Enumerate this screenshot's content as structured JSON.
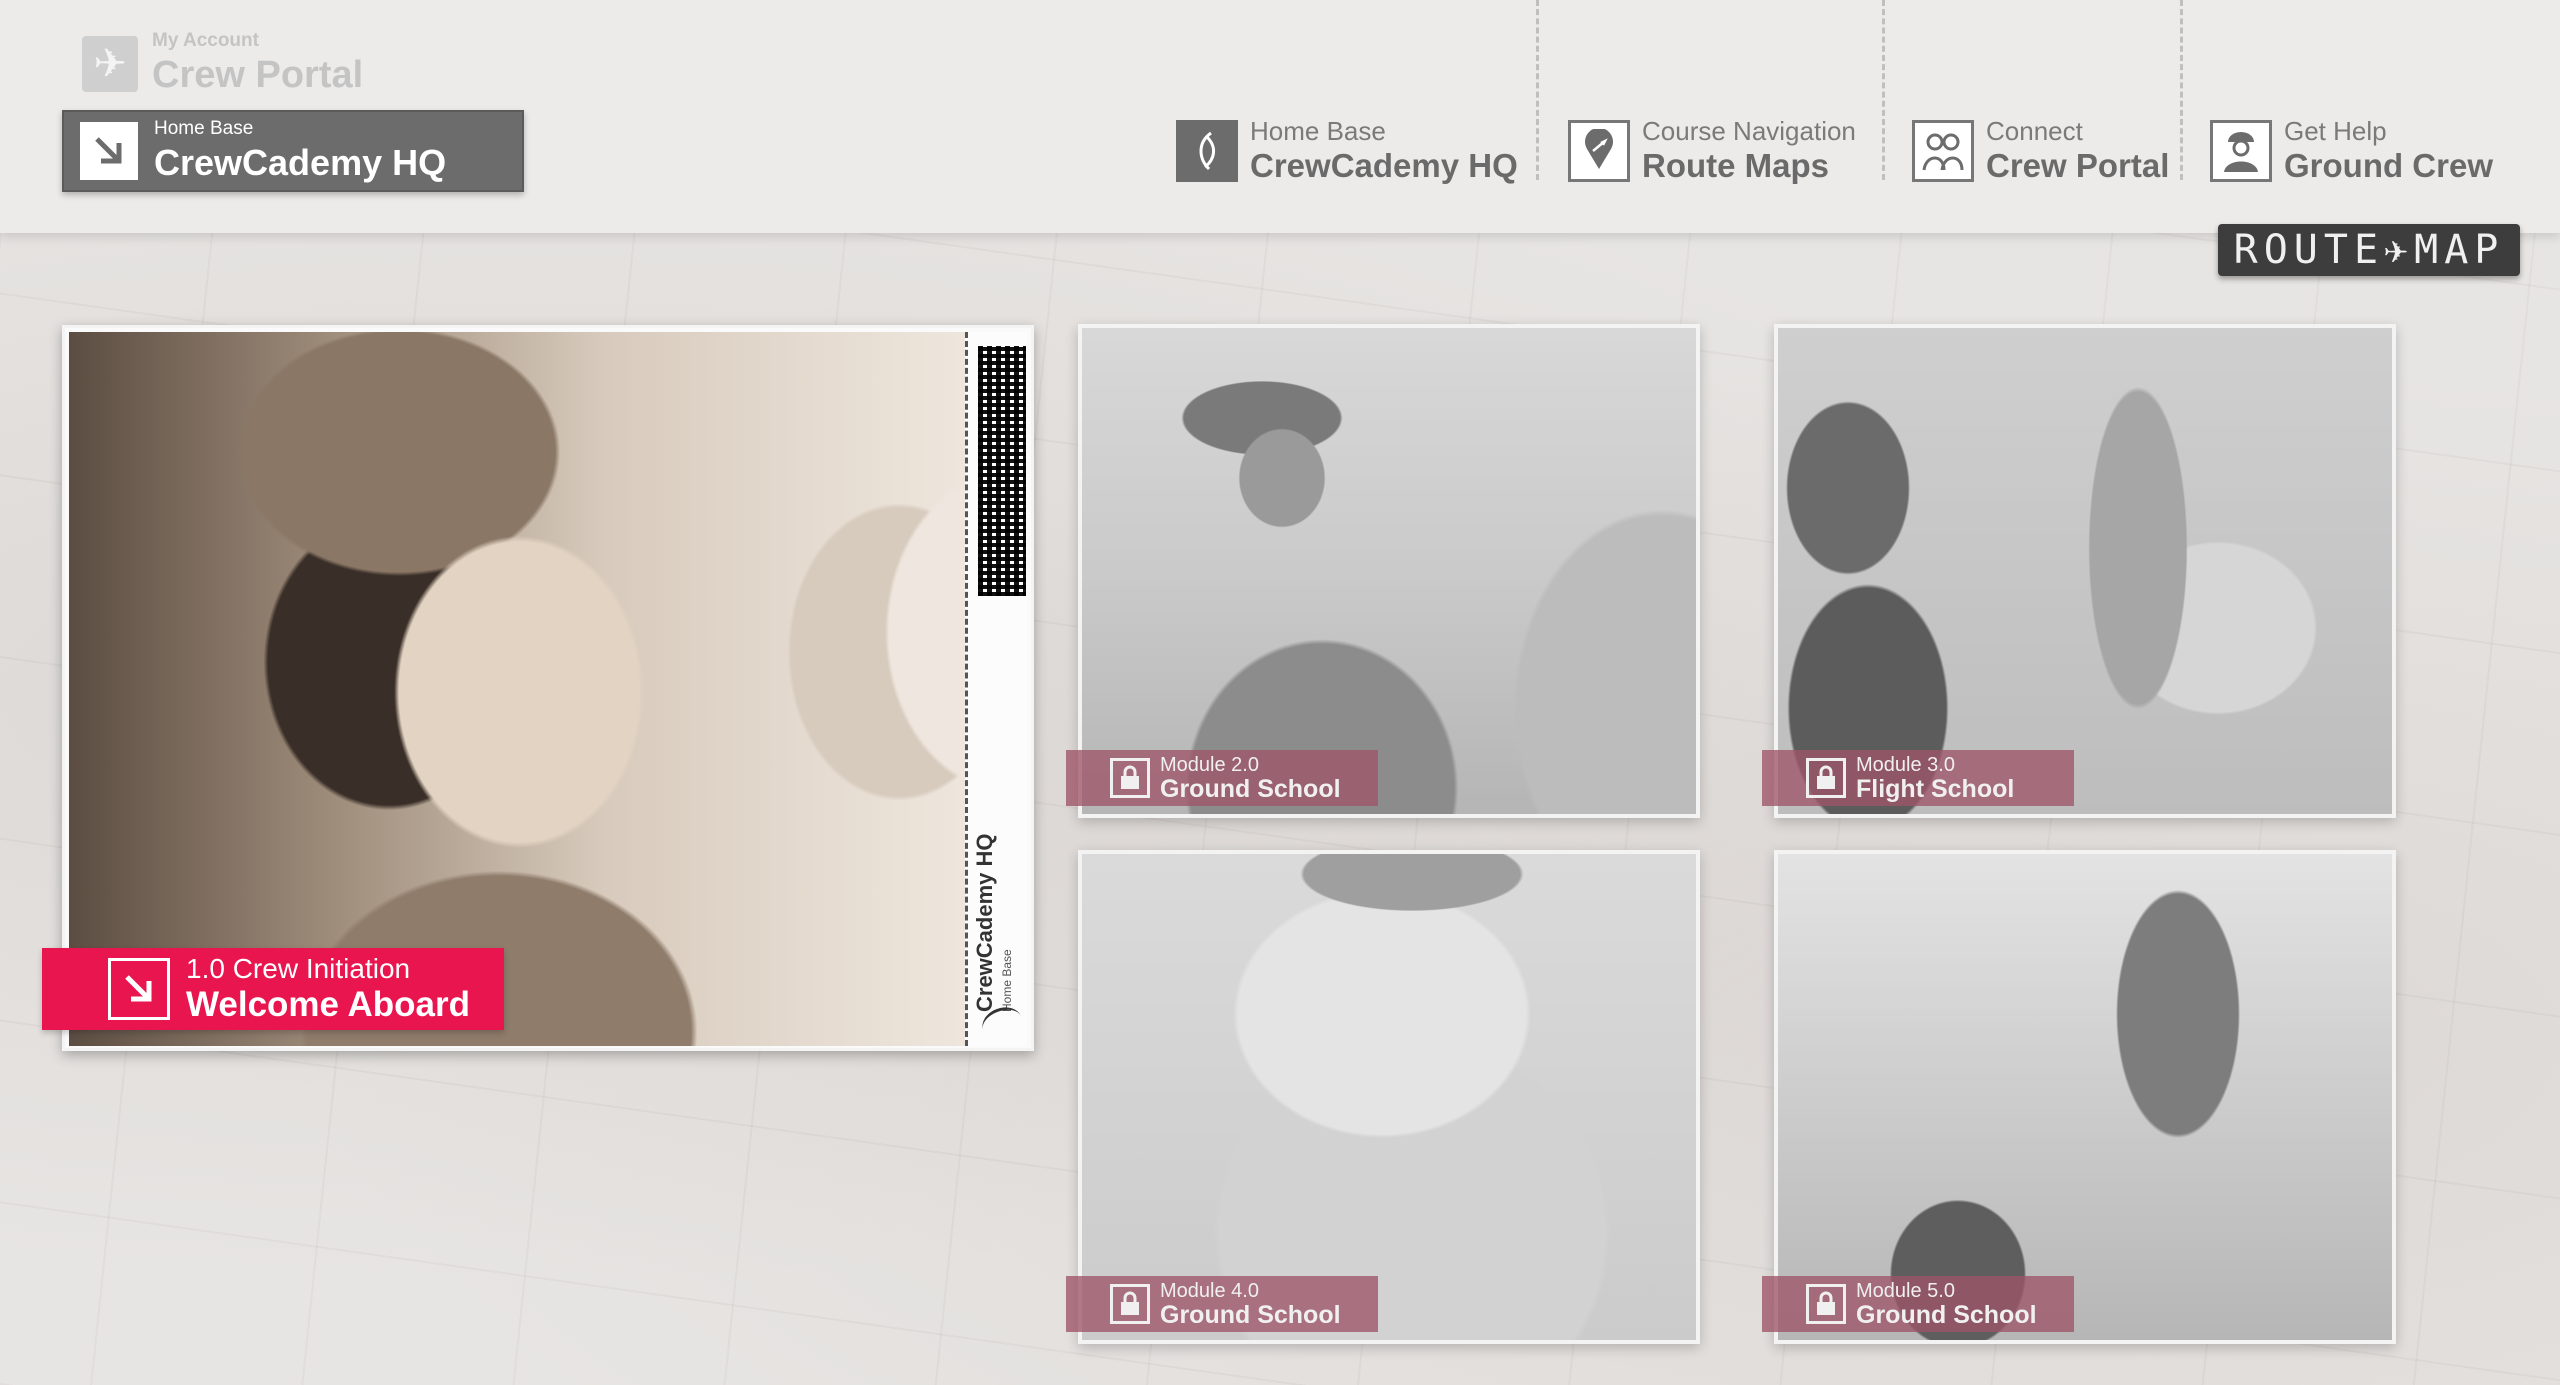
{
  "header": {
    "account": {
      "label_small": "My Account",
      "label_big": "Crew Portal",
      "icon": "plane-icon"
    },
    "home_base": {
      "label_small": "Home Base",
      "label_big": "CrewCademy HQ",
      "icon": "arrow-down-right-icon"
    },
    "nav": [
      {
        "small": "Home Base",
        "big": "CrewCademy HQ",
        "icon": "wing-logo-icon"
      },
      {
        "small": "Course Navigation",
        "big": "Route Maps",
        "icon": "map-pin-icon"
      },
      {
        "small": "Connect",
        "big": "Crew Portal",
        "icon": "crew-people-icon"
      },
      {
        "small": "Get Help",
        "big": "Ground Crew",
        "icon": "ground-crew-icon"
      }
    ],
    "route_map_badge": "ROUTE✈MAP"
  },
  "main": {
    "stub_title": "CrewCademy HQ",
    "stub_subtitle": "Home Base",
    "welcome": {
      "small": "1.0 Crew Initiation",
      "big": "Welcome Aboard",
      "icon": "arrow-down-right-icon"
    }
  },
  "modules": [
    {
      "small": "Module 2.0",
      "big": "Ground School",
      "icon": "lock-icon"
    },
    {
      "small": "Module 3.0",
      "big": "Flight School",
      "icon": "lock-icon"
    },
    {
      "small": "Module 4.0",
      "big": "Ground School",
      "icon": "lock-icon"
    },
    {
      "small": "Module 5.0",
      "big": "Ground School",
      "icon": "lock-icon"
    }
  ],
  "colors": {
    "accent": "#e8154f",
    "locked_label": "#9e5468",
    "header_dark": "#6c6c6c"
  }
}
